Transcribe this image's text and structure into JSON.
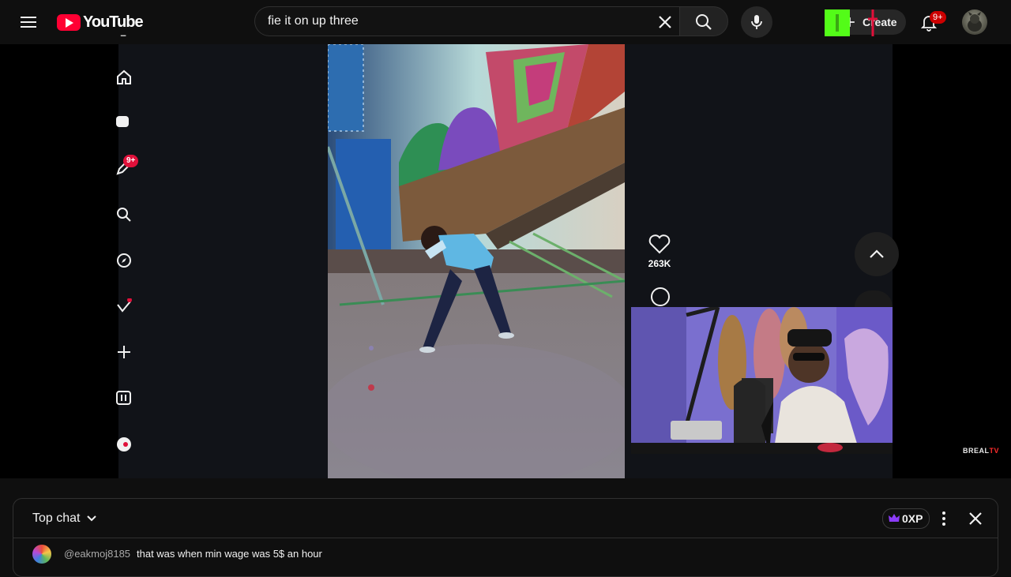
{
  "header": {
    "logo_text": "YouTube",
    "search_value": "fie it on up three",
    "create_label": "Create",
    "notifications_badge": "9+"
  },
  "sidebar": {
    "badge": "9+"
  },
  "video_overlay": {
    "like_count": "263K",
    "watermark_brand": "BREAL",
    "watermark_suffix": "TV"
  },
  "chat": {
    "title": "Top chat",
    "xp_label": "0XP",
    "messages": [
      {
        "author": "@eakmoj8185",
        "text": "that was when min wage was 5$ an hour"
      }
    ]
  },
  "colors": {
    "brand_red": "#ff0033",
    "badge_red": "#cc0000",
    "background": "#0f0f0f",
    "k_green": "#53fc18",
    "xp_purple": "#8b3cf7"
  }
}
